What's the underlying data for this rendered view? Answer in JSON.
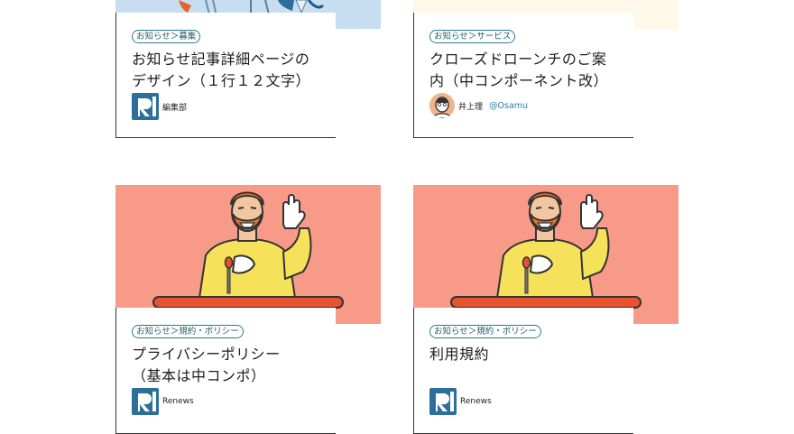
{
  "cards": [
    {
      "category": "お知らせ＞募集",
      "title_line1": "お知らせ記事詳細ページの",
      "title_line2": "デザイン（１行１２文字）",
      "author_name": "編集部",
      "image_bg": "#c7def0"
    },
    {
      "category": "お知らせ＞サービス",
      "title_line1": "クローズドローンチのご案",
      "title_line2": "内（中コンポーネント改）",
      "author_name": "井上理",
      "author_handle": "@Osamu",
      "image_bg": "#fdf8e8"
    },
    {
      "category": "お知らせ＞規約・ポリシー",
      "title_line1": "プライバシーポリシー",
      "title_line2": "（基本は中コンポ）",
      "author_name": "Renews",
      "image_bg": "#f79a88"
    },
    {
      "category": "お知らせ＞規約・ポリシー",
      "title_line1": "利用規約",
      "title_line2": "",
      "author_name": "Renews",
      "image_bg": "#f79a88"
    }
  ],
  "colors": {
    "brand_logo": "#2b6f9a",
    "category_border": "#2c7a8c",
    "handle": "#2f7fa0"
  },
  "icons": {
    "site_logo": "renews-logo-icon",
    "user_avatar": "user-avatar-icon",
    "hero_image": "speaker-illustration"
  }
}
